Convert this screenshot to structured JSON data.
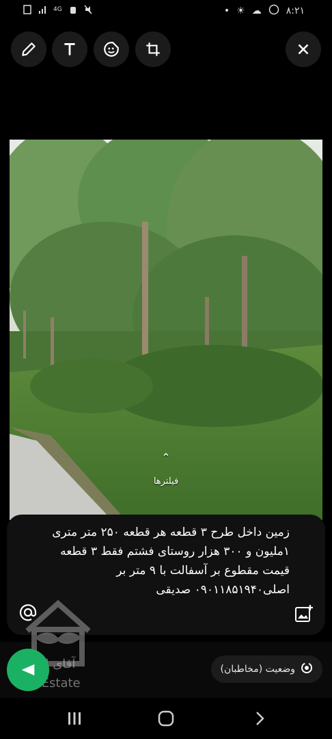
{
  "status_bar": {
    "time": "۸:۲۱",
    "network": "4G",
    "left_icons": [
      "gallery-icon",
      "signal-icon",
      "network-type-icon",
      "alarm-icon",
      "mute-icon"
    ],
    "right_icons": [
      "dot-icon",
      "weather-icon",
      "cloud-icon",
      "whatsapp-icon"
    ]
  },
  "toolbar": {
    "tools": [
      "pencil-icon",
      "text-icon",
      "sticker-icon",
      "crop-rotate-icon"
    ],
    "close": "close-icon"
  },
  "photo": {
    "description_icon": "landscape-photo"
  },
  "filters": {
    "label": "فیلترها",
    "icon": "chevron-up-icon"
  },
  "caption": {
    "text": "زمین داخل طرح ۳ قطعه  هر قطعه ۲۵۰ متر متری ۱ملیون و ۳۰۰ هزار روستای فشتم فقط ۳ قطعه قیمت مقطوع بر آسفالت با ۹ متر بر اصلی۰۹۰۱۱۸۵۱۹۴۰ صدیقی"
  },
  "audience": {
    "label": "وضعیت (مخاطبان)",
    "icon": "status-ring-icon"
  },
  "watermark": {
    "fa": "آقای املاک",
    "en": "Mr Estate"
  },
  "colors": {
    "send": "#1bb164",
    "background": "#000000",
    "caption_bg": "#111111"
  }
}
